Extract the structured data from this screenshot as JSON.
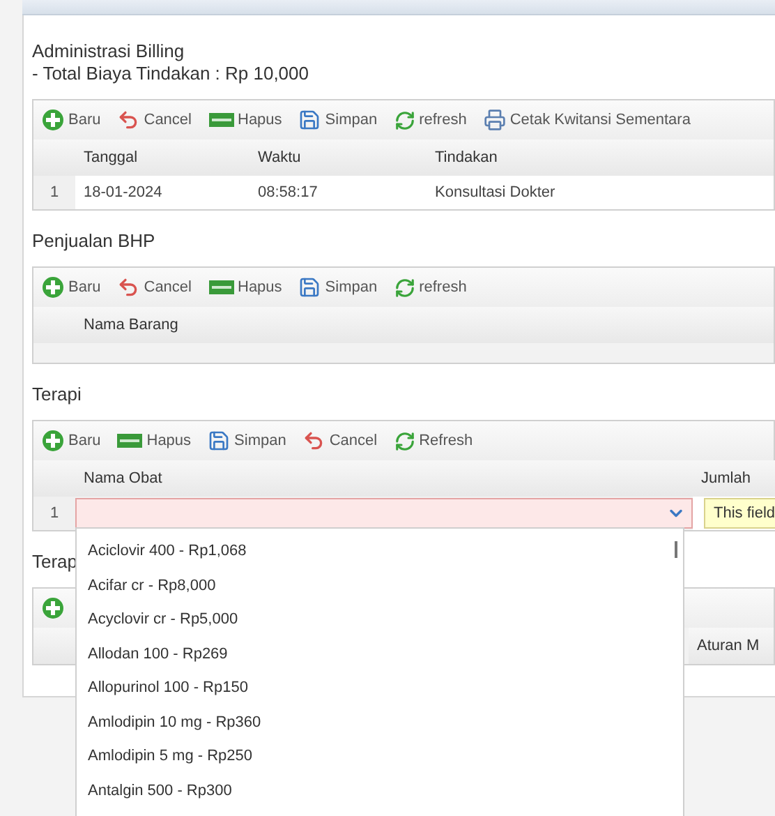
{
  "sections": [
    {
      "title": "Administrasi Billing",
      "subtitle": "- Total Biaya Tindakan : Rp 10,000",
      "toolbar": [
        {
          "kind": "add",
          "label": "Baru"
        },
        {
          "kind": "cancel",
          "label": "Cancel"
        },
        {
          "kind": "delete",
          "label": "Hapus"
        },
        {
          "kind": "save",
          "label": "Simpan"
        },
        {
          "kind": "refresh",
          "label": "refresh"
        },
        {
          "kind": "print",
          "label": "Cetak Kwitansi Sementara"
        }
      ],
      "columns": [
        "Tanggal",
        "Waktu",
        "Tindakan"
      ],
      "rows": [
        {
          "kind": "data",
          "number": "1",
          "cells": [
            "18-01-2024",
            "08:58:17",
            "Konsultasi Dokter"
          ]
        }
      ]
    },
    {
      "title": "Penjualan BHP",
      "toolbar": [
        {
          "kind": "add",
          "label": "Baru"
        },
        {
          "kind": "cancel",
          "label": "Cancel"
        },
        {
          "kind": "delete",
          "label": "Hapus"
        },
        {
          "kind": "save",
          "label": "Simpan"
        },
        {
          "kind": "refresh",
          "label": "refresh"
        }
      ],
      "columns": [
        "Nama Barang"
      ]
    },
    {
      "title": "Terapi",
      "toolbar": [
        {
          "kind": "add",
          "label": "Baru"
        },
        {
          "kind": "delete",
          "label": "Hapus"
        },
        {
          "kind": "save",
          "label": "Simpan"
        },
        {
          "kind": "cancel",
          "label": "Cancel"
        },
        {
          "kind": "refresh",
          "label": "Refresh"
        }
      ],
      "columns": [
        "Nama Obat",
        "Jumlah"
      ],
      "rows": [
        {
          "kind": "editor",
          "number": "1",
          "invalid": true,
          "tooltip": "This field",
          "dropdown": [
            "Aciclovir 400 - Rp1,068",
            "Acifar cr - Rp8,000",
            "Acyclovir cr - Rp5,000",
            "Allodan 100 - Rp269",
            "Allopurinol 100 - Rp150",
            "Amlodipin 10 mg - Rp360",
            "Amlodipin 5 mg - Rp250",
            "Antalgin 500 - Rp300"
          ]
        }
      ]
    },
    {
      "title": "Terap",
      "toolbar": [
        {
          "kind": "add"
        }
      ],
      "columns": [
        "Aturan M"
      ]
    }
  ]
}
